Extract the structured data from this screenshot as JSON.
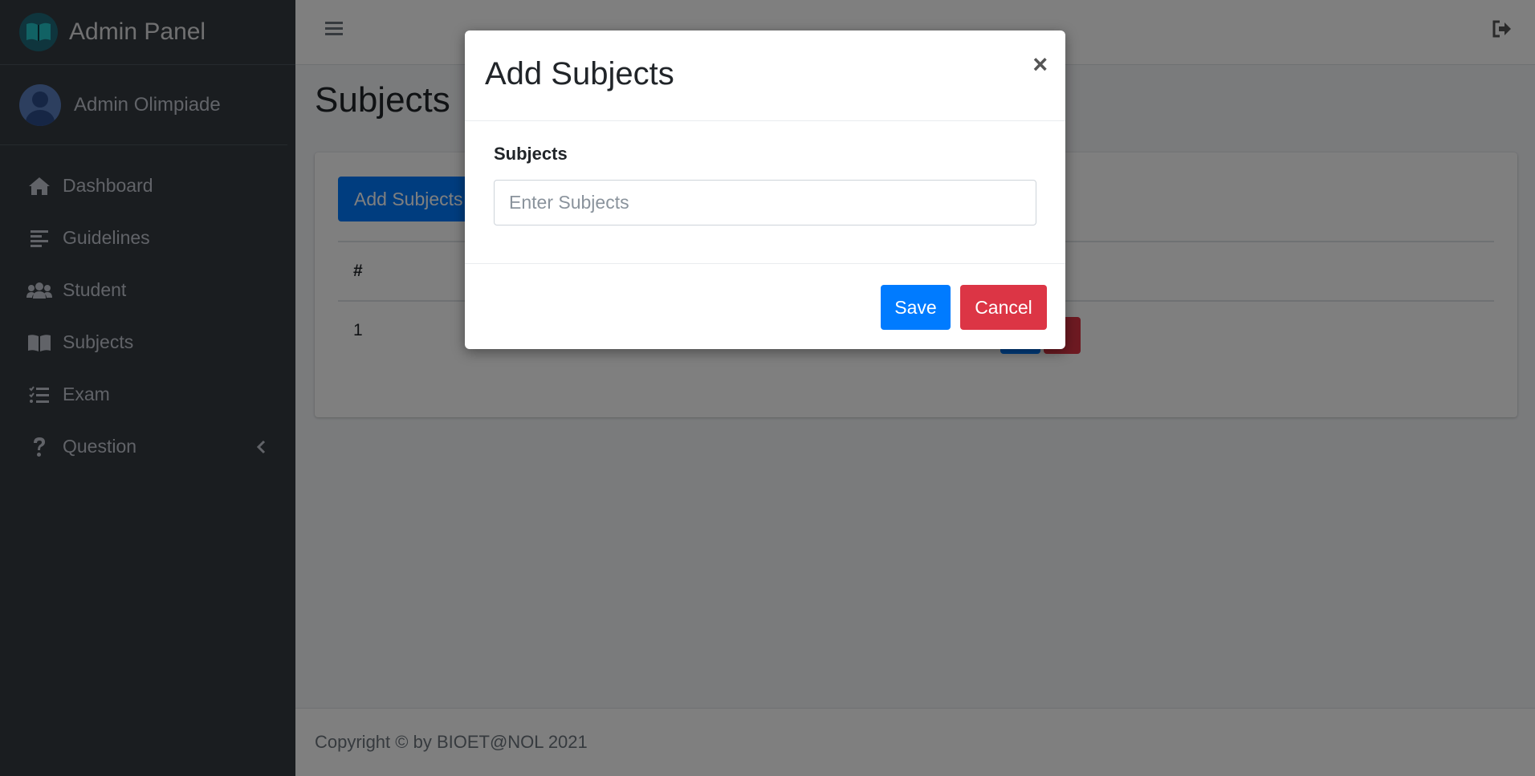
{
  "brand": {
    "title": "Admin Panel",
    "logo_icon": "open-book-icon"
  },
  "user": {
    "name": "Admin Olimpiade"
  },
  "sidebar": {
    "items": [
      {
        "label": "Dashboard",
        "icon": "home-icon"
      },
      {
        "label": "Guidelines",
        "icon": "align-left-icon"
      },
      {
        "label": "Student",
        "icon": "users-icon"
      },
      {
        "label": "Subjects",
        "icon": "book-icon"
      },
      {
        "label": "Exam",
        "icon": "tasks-icon"
      },
      {
        "label": "Question",
        "icon": "question-icon"
      }
    ]
  },
  "page": {
    "title": "Subjects"
  },
  "card": {
    "add_button": "Add Subjects",
    "table": {
      "headers": [
        "#"
      ],
      "rows": [
        {
          "no": "1"
        }
      ]
    }
  },
  "footer": {
    "copyright": "Copyright © by BIOET@NOL 2021"
  },
  "modal": {
    "title": "Add Subjects",
    "close": "×",
    "field_label": "Subjects",
    "field_placeholder": "Enter Subjects",
    "save": "Save",
    "cancel": "Cancel"
  },
  "colors": {
    "sidebar_bg": "#343a40",
    "primary": "#007bff",
    "danger": "#dc3545"
  }
}
